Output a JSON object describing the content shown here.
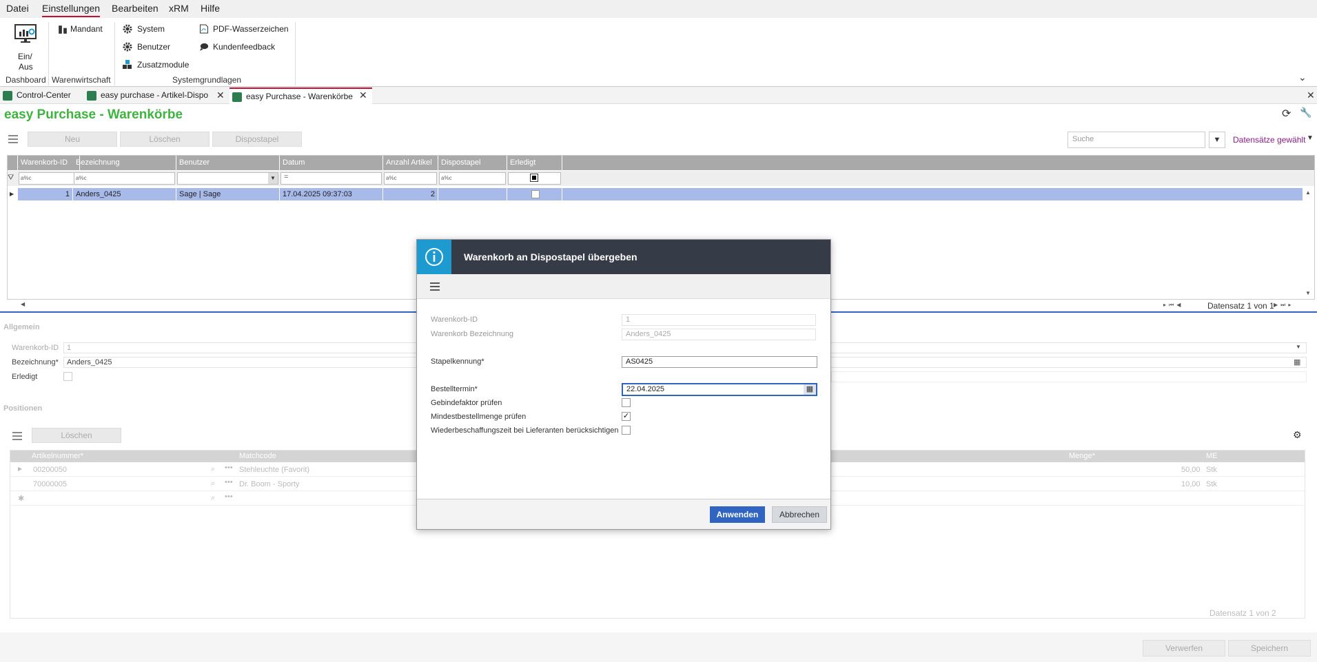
{
  "menu": {
    "items": [
      "Datei",
      "Einstellungen",
      "Bearbeiten",
      "xRM",
      "Hilfe"
    ],
    "active": "Einstellungen"
  },
  "ribbon": {
    "dashboard_button": "Ein/\nAus",
    "dashboard_button_line1": "Ein/",
    "dashboard_button_line2": "Aus",
    "mandant": "Mandant",
    "system": "System",
    "benutzer": "Benutzer",
    "zusatzmodule": "Zusatzmodule",
    "pdf_wasserzeichen": "PDF-Wasserzeichen",
    "kundenfeedback": "Kundenfeedback",
    "groups": [
      "Dashboard",
      "Warenwirtschaft",
      "Systemgrundlagen"
    ]
  },
  "tabs": [
    {
      "label": "Control-Center"
    },
    {
      "label": "easy purchase  - Artikel-Dispo"
    },
    {
      "label": "easy Purchase - Warenkörbe"
    }
  ],
  "page": {
    "title": "easy Purchase - Warenkörbe"
  },
  "toolbar": {
    "neu": "Neu",
    "loeschen": "Löschen",
    "dispostapel": "Dispostapel",
    "search_placeholder": "Suche",
    "records_selected": "Datensätze gewählt"
  },
  "grid": {
    "columns": [
      "Warenkorb-ID",
      "Bezeichnung",
      "Benutzer",
      "Datum",
      "Anzahl Artikel",
      "Dispostapel",
      "Erledigt"
    ],
    "filter_hint": "a%c",
    "filter_eq": "=",
    "rows": [
      {
        "id": "1",
        "bezeichnung": "Anders_0425",
        "benutzer": "Sage  |  Sage",
        "datum": "17.04.2025 09:37:03",
        "anzahl": "2",
        "dispostapel": ""
      }
    ],
    "pager": "Datensatz 1 von 1"
  },
  "details": {
    "section_allgemein": "Allgemein",
    "warenkorb_id_label": "Warenkorb-ID",
    "warenkorb_id_value": "1",
    "bezeichnung_label": "Bezeichnung*",
    "bezeichnung_value": "Anders_0425",
    "erledigt_label": "Erledigt",
    "section_positionen": "Positionen",
    "loeschen": "Löschen",
    "pos_columns": [
      "Artikelnummer*",
      "Matchcode",
      "Menge*",
      "ME"
    ],
    "pos_rows": [
      {
        "nr": "00200050",
        "match": "Stehleuchte  (Favorit)",
        "menge": "50,00",
        "me": "Stk"
      },
      {
        "nr": "70000005",
        "match": "Dr. Boom - Sporty",
        "menge": "10,00",
        "me": "Stk"
      }
    ],
    "pos_pager": "Datensatz 1 von 2"
  },
  "footer": {
    "verwerfen": "Verwerfen",
    "speichern": "Speichern"
  },
  "dialog": {
    "title": "Warenkorb an Dispostapel übergeben",
    "warenkorb_id_label": "Warenkorb-ID",
    "warenkorb_id_value": "1",
    "bezeichnung_label": "Warenkorb Bezeichnung",
    "bezeichnung_value": "Anders_0425",
    "stapelkennung_label": "Stapelkennung*",
    "stapelkennung_value": "AS0425",
    "bestelltermin_label": "Bestelltermin*",
    "bestelltermin_value": "22.04.2025",
    "gebindefaktor_label": "Gebindefaktor prüfen",
    "mindestbestellmenge_label": "Mindestbestellmenge prüfen",
    "wiederbeschaffung_label": "Wiederbeschaffungszeit bei Lieferanten berücksichtigen",
    "apply": "Anwenden",
    "cancel": "Abbrechen"
  },
  "colors": {
    "accent_red": "#c8102e",
    "title_green": "#3fb33f",
    "selected_row": "#a8baea",
    "dialog_header": "#353c47",
    "dialog_icon": "#1d9bd1",
    "apply_button": "#2f64c2",
    "link_purple": "#8b1a8b"
  }
}
